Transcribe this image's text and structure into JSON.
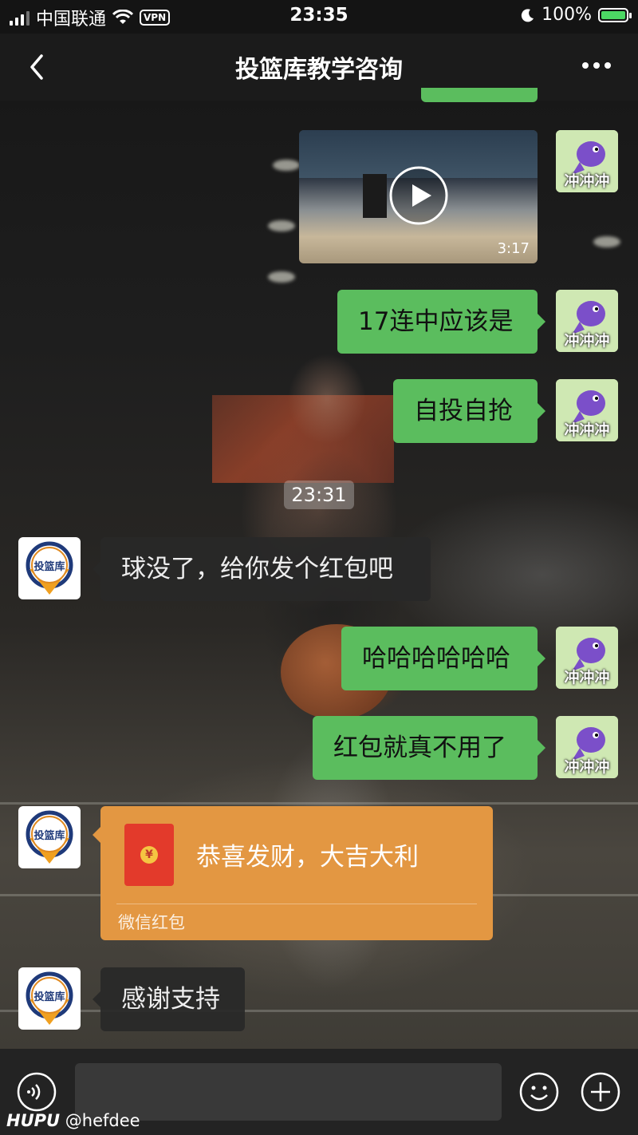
{
  "status_bar": {
    "carrier": "中国联通",
    "vpn": "VPN",
    "time": "23:35",
    "battery": "100%"
  },
  "nav": {
    "title": "投篮库教学咨询"
  },
  "video": {
    "duration": "3:17"
  },
  "me_label": "冲冲冲",
  "messages": {
    "m1": "17连中应该是",
    "m2": "自投自抢",
    "ts": "23:31",
    "m3": "球没了，给你发个红包吧",
    "m4": "哈哈哈哈哈哈",
    "m5": "红包就真不用了",
    "m7": "感谢支持"
  },
  "red_packet": {
    "title": "恭喜发财，大吉大利",
    "label": "微信红包",
    "coin": "¥"
  },
  "avatar_text": "投篮库",
  "watermark": {
    "brand": "HUPU",
    "user": "@hefdee"
  },
  "colors": {
    "bubble_me": "#5bbd5e",
    "red_packet": "#e39742",
    "avatar_ring": "#1f3a7a"
  }
}
